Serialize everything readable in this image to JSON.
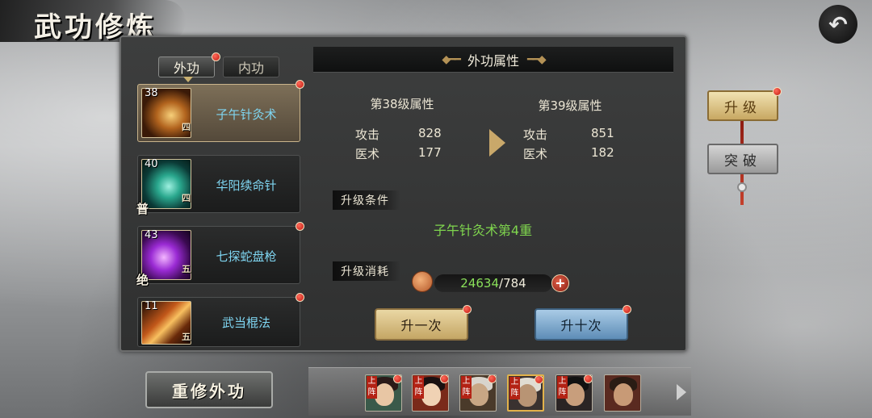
{
  "header": {
    "title": "武功修炼"
  },
  "tabs": [
    {
      "label": "外功",
      "active": true,
      "badge": true
    },
    {
      "label": "内功",
      "active": false,
      "badge": false
    }
  ],
  "skills": [
    {
      "level": "38",
      "tier": "四",
      "rank": "",
      "name": "子午针灸术",
      "selected": true,
      "badge": true,
      "icon": "golden-swirl-skill-icon"
    },
    {
      "level": "40",
      "tier": "四",
      "rank": "普",
      "name": "华阳续命针",
      "selected": false,
      "badge": false,
      "icon": "teal-needle-skill-icon"
    },
    {
      "level": "43",
      "tier": "五",
      "rank": "绝",
      "name": "七探蛇盘枪",
      "selected": false,
      "badge": true,
      "icon": "purple-spear-skill-icon"
    },
    {
      "level": "11",
      "tier": "五",
      "rank": "",
      "name": "武当棍法",
      "selected": false,
      "badge": true,
      "icon": "orange-staff-skill-icon"
    }
  ],
  "rebuild_button": "重修外功",
  "panel": {
    "title": "外功属性",
    "current": {
      "title": "第38级属性",
      "stats": [
        {
          "label": "攻击",
          "value": "828"
        },
        {
          "label": "医术",
          "value": "177"
        }
      ]
    },
    "next": {
      "title": "第39级属性",
      "stats": [
        {
          "label": "攻击",
          "value": "851"
        },
        {
          "label": "医术",
          "value": "182"
        }
      ]
    },
    "condition_label": "升级条件",
    "condition_text": "子午针灸术第4重",
    "cost_label": "升级消耗",
    "cost_have": "24634",
    "cost_separator": "/",
    "cost_need": "784",
    "plus_label": "+",
    "upgrade_once": "升一次",
    "upgrade_ten": "升十次"
  },
  "side_tabs": {
    "upgrade": "升级",
    "breakthrough": "突破"
  },
  "heroes": [
    {
      "tag": "上阵",
      "badge": true,
      "hair": "#2a1a18",
      "skin": "#e8c6a4",
      "bg": "#3a5a4a"
    },
    {
      "tag": "上阵",
      "badge": true,
      "hair": "#1a1010",
      "skin": "#f0d2b4",
      "bg": "#7a2a1a"
    },
    {
      "tag": "上阵",
      "badge": true,
      "hair": "#d8d4cc",
      "skin": "#c8a684",
      "bg": "#4a3a2a"
    },
    {
      "tag": "上阵",
      "badge": true,
      "hair": "#e0dcd2",
      "skin": "#b89474",
      "bg": "#3a3230"
    },
    {
      "tag": "上阵",
      "badge": true,
      "hair": "#111111",
      "skin": "#c89e7c",
      "bg": "#2a2424"
    },
    {
      "tag": "",
      "badge": false,
      "hair": "#2a1c14",
      "skin": "#c89a76",
      "bg": "#5a2a20"
    }
  ],
  "colors": {
    "skill_name": "#7fd6f2",
    "condition": "#7fd64e",
    "cost_have": "#8ae05a",
    "badge_red": "#c01a10"
  }
}
